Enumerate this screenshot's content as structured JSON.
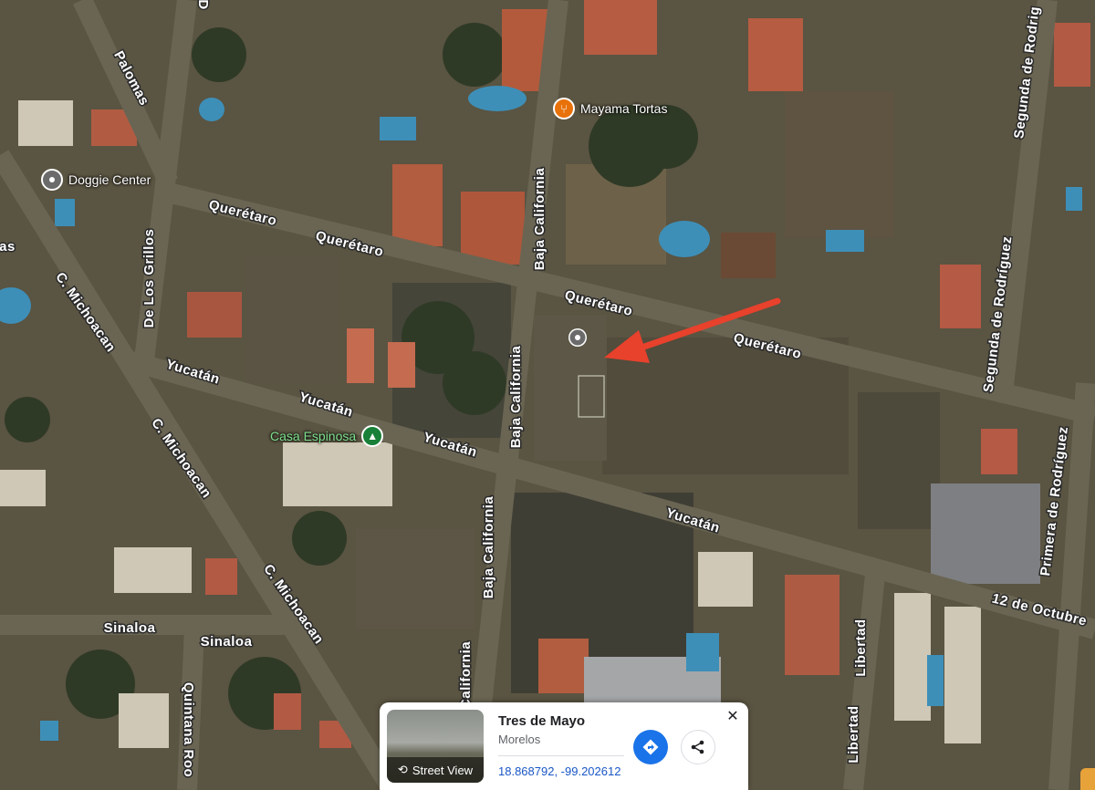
{
  "streets": [
    {
      "name": "Palomas"
    },
    {
      "name": "Querétaro"
    },
    {
      "name": "Querétaro"
    },
    {
      "name": "Querétaro"
    },
    {
      "name": "Querétaro"
    },
    {
      "name": "De Los Grillos"
    },
    {
      "name": "C. Michoacan"
    },
    {
      "name": "C. Michoacan"
    },
    {
      "name": "C. Michoacan"
    },
    {
      "name": "Yucatán"
    },
    {
      "name": "Yucatán"
    },
    {
      "name": "Yucatán"
    },
    {
      "name": "Yucatán"
    },
    {
      "name": "Baja California"
    },
    {
      "name": "Baja California"
    },
    {
      "name": "Baja California"
    },
    {
      "name": "California"
    },
    {
      "name": "Segunda de Rodríguez"
    },
    {
      "name": "Segunda de Rodrig"
    },
    {
      "name": "Primera de Rodríguez"
    },
    {
      "name": "12 de Octubre"
    },
    {
      "name": "Libertad"
    },
    {
      "name": "Libertad"
    },
    {
      "name": "Sinaloa"
    },
    {
      "name": "Sinaloa"
    },
    {
      "name": "Quintana Roo"
    },
    {
      "name": "as"
    },
    {
      "name": "D"
    }
  ],
  "pois": [
    {
      "name": "Mayama Tortas",
      "icon": "restaurant-icon",
      "color": "#e8710a"
    },
    {
      "name": "Doggie Center",
      "icon": "place-pin-icon",
      "color": "#6b6b6b"
    },
    {
      "name": "Casa Espinosa",
      "icon": "park-tree-icon",
      "color": "#188038"
    }
  ],
  "dropped_pin": {
    "icon": "place-pin-icon"
  },
  "annotation_arrow": {
    "color": "#e8412c"
  },
  "info_card": {
    "title": "Tres de Mayo",
    "subtitle": "Morelos",
    "coordinates": "18.868792, -99.202612",
    "street_view_label": "Street View",
    "accent": "#1a73e8"
  }
}
